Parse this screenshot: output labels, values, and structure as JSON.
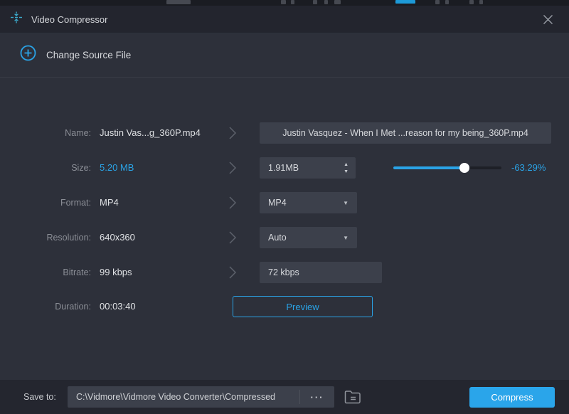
{
  "window": {
    "title": "Video Compressor"
  },
  "header": {
    "change_source_label": "Change Source File"
  },
  "rows": {
    "name": {
      "label": "Name:",
      "value": "Justin Vas...g_360P.mp4",
      "input": "Justin Vasquez - When I Met ...reason for my being_360P.mp4"
    },
    "size": {
      "label": "Size:",
      "value": "5.20 MB",
      "input": "1.91MB",
      "percent": "-63.29%",
      "slider_percent": 66
    },
    "format": {
      "label": "Format:",
      "value": "MP4",
      "selected": "MP4"
    },
    "resolution": {
      "label": "Resolution:",
      "value": "640x360",
      "selected": "Auto"
    },
    "bitrate": {
      "label": "Bitrate:",
      "value": "99 kbps",
      "input": "72 kbps"
    },
    "duration": {
      "label": "Duration:",
      "value": "00:03:40",
      "button": "Preview"
    }
  },
  "footer": {
    "save_to_label": "Save to:",
    "path": "C:\\Vidmore\\Vidmore Video Converter\\Compressed",
    "browse_label": "···",
    "compress_label": "Compress"
  },
  "icons": {
    "spin_up": "▲",
    "spin_down": "▼",
    "dropdown": "▼"
  },
  "colors": {
    "accent_blue": "#2AA3E6",
    "compress_button": "#2AA5EA",
    "dialog_background": "#2D303A",
    "titlebar_background": "#23252E",
    "field_background": "#3C404B",
    "label_gray": "#8B8E96"
  }
}
